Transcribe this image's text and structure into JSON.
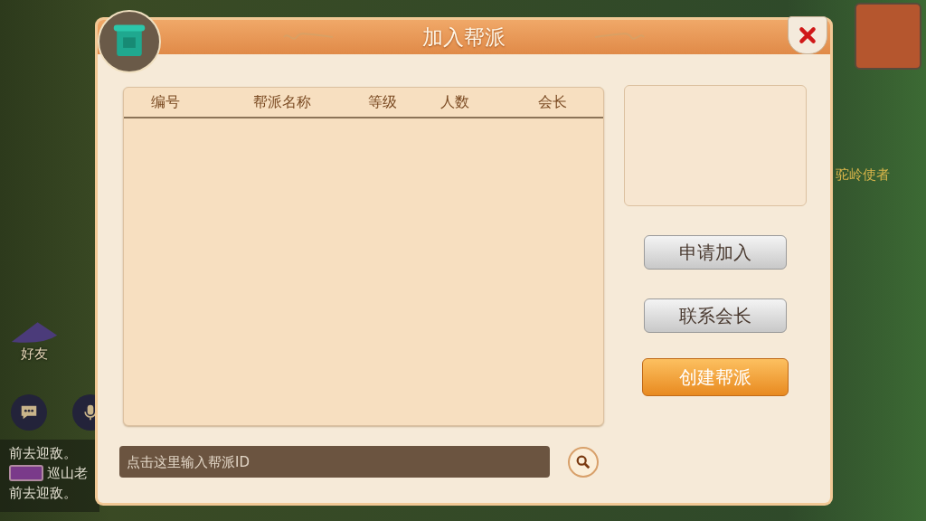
{
  "scene": {
    "friend_label": "好友",
    "npc_name": "驼岭使者",
    "chat_lines": [
      {
        "tag": false,
        "text": "前去迎敌。"
      },
      {
        "tag": true,
        "text": "巡山老"
      },
      {
        "tag": false,
        "text": "前去迎敌。"
      }
    ]
  },
  "dialog": {
    "title": "加入帮派",
    "table": {
      "columns": [
        "编号",
        "帮派名称",
        "等级",
        "人数",
        "会长"
      ]
    },
    "buttons": [
      {
        "label": "申请加入",
        "kind": "grey"
      },
      {
        "label": "联系会长",
        "kind": "grey"
      },
      {
        "label": "创建帮派",
        "kind": "orange"
      }
    ],
    "search": {
      "placeholder": "点击这里输入帮派ID"
    }
  }
}
